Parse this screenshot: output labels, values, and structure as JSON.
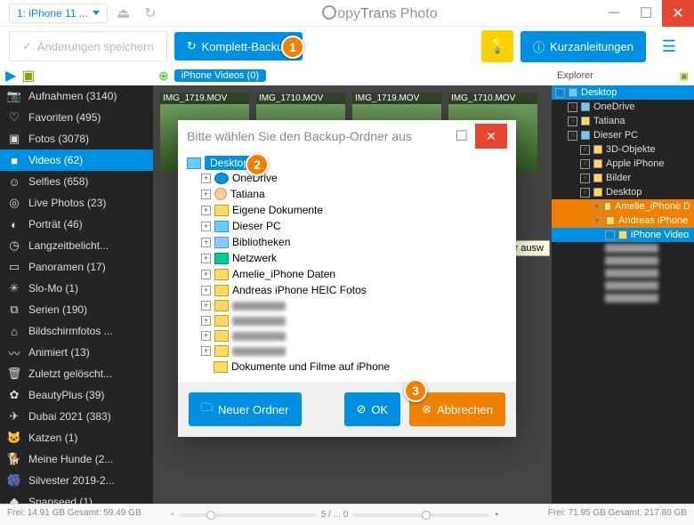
{
  "titlebar": {
    "device": "1: iPhone 11 ...",
    "app_name_prefix": "opy",
    "app_name_main": "Trans",
    "app_name_suffix": " Photo"
  },
  "toolbar": {
    "save_changes": "Änderungen speichern",
    "full_backup": "Komplett-Backup",
    "quickguides": "Kurzanleitungen"
  },
  "sidebar": {
    "items": [
      {
        "icon": "📷",
        "label": "Aufnahmen (3140)"
      },
      {
        "icon": "♡",
        "label": "Favoriten (495)"
      },
      {
        "icon": "▣",
        "label": "Fotos (3078)"
      },
      {
        "icon": "■",
        "label": "Videos (62)",
        "active": true
      },
      {
        "icon": "☺",
        "label": "Selfies (658)"
      },
      {
        "icon": "◎",
        "label": "Live Photos (23)"
      },
      {
        "icon": "◐",
        "label": "Porträt (46)"
      },
      {
        "icon": "◷",
        "label": "Langzeitbelicht..."
      },
      {
        "icon": "▭",
        "label": "Panoramen (17)"
      },
      {
        "icon": "✳",
        "label": "Slo-Mo (1)"
      },
      {
        "icon": "⧉",
        "label": "Serien (190)"
      },
      {
        "icon": "⌂",
        "label": "Bildschirmfotos ..."
      },
      {
        "icon": "〰",
        "label": "Animiert (13)"
      },
      {
        "icon": "🗑",
        "label": "Zuletzt gelöscht..."
      },
      {
        "icon": "✿",
        "label": "BeautyPlus (39)"
      },
      {
        "icon": "✈",
        "label": "Dubai 2021 (383)"
      },
      {
        "icon": "🐱",
        "label": "Katzen (1)"
      },
      {
        "icon": "🐕",
        "label": "Meine Hunde (2..."
      },
      {
        "icon": "🎆",
        "label": "Silvester 2019-2..."
      },
      {
        "icon": "◆",
        "label": "Snapseed (1)"
      }
    ]
  },
  "center": {
    "header_pill": "iPhone Videos (0)",
    "thumbs": [
      {
        "label": "IMG_1719.MOV"
      },
      {
        "label": "IMG_1710.MOV"
      }
    ]
  },
  "right": {
    "header": "Explorer",
    "tree": [
      {
        "indent": 0,
        "ico": "monitor",
        "label": "Desktop",
        "hl": "blue"
      },
      {
        "indent": 1,
        "ico": "onedrive",
        "label": "OneDrive"
      },
      {
        "indent": 1,
        "ico": "user",
        "label": "Tatiana"
      },
      {
        "indent": 1,
        "ico": "monitor",
        "label": "Dieser PC"
      },
      {
        "indent": 2,
        "ico": "folder",
        "label": "3D-Objekte"
      },
      {
        "indent": 2,
        "ico": "folder",
        "label": "Apple iPhone"
      },
      {
        "indent": 2,
        "ico": "folder",
        "label": "Bilder"
      },
      {
        "indent": 2,
        "ico": "folder",
        "label": "Desktop"
      },
      {
        "indent": 3,
        "ico": "folder",
        "label": "Amelie_iPhone D",
        "hl": "orange"
      },
      {
        "indent": 3,
        "ico": "folder",
        "label": "Andreas iPhone ",
        "hl": "orange"
      },
      {
        "indent": 4,
        "ico": "folder",
        "label": "iPhone Video",
        "hl": "blue"
      }
    ]
  },
  "dialog": {
    "title": "Bitte wählen Sie den Backup-Ordner aus",
    "selected": "Desktop",
    "items": [
      {
        "ico": "onedrive",
        "label": "OneDrive"
      },
      {
        "ico": "user",
        "label": "Tatiana"
      },
      {
        "ico": "folder",
        "label": "Eigene Dokumente"
      },
      {
        "ico": "monitor",
        "label": "Dieser PC"
      },
      {
        "ico": "lib",
        "label": "Bibliotheken"
      },
      {
        "ico": "net",
        "label": "Netzwerk"
      },
      {
        "ico": "folder",
        "label": "Amelie_iPhone Daten"
      },
      {
        "ico": "folder",
        "label": "Andreas iPhone HEIC Fotos"
      }
    ],
    "last_item": "Dokumente und Filme auf iPhone",
    "new_folder": "Neuer Ordner",
    "ok": "OK",
    "cancel": "Abbrechen"
  },
  "tooltip": "Ordner ausw",
  "status": {
    "left": "Frei: 14.91 GB Gesamt: 59.49 GB",
    "mid": "5 / ... 0",
    "right": "Frei: 71.95 GB Gesamt: 217.80 GB"
  },
  "markers": {
    "m1": "1",
    "m2": "2",
    "m3": "3"
  }
}
